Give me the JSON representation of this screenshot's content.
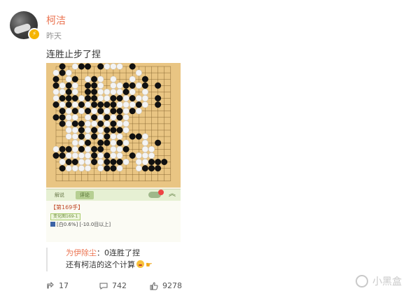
{
  "post": {
    "author": "柯洁",
    "time": "昨天",
    "text": "连胜止步了捏",
    "verified_badge_icon": "v-badge-icon"
  },
  "screenshot": {
    "board": {
      "size": 19,
      "black": [
        [
          1,
          0
        ],
        [
          1,
          1
        ],
        [
          4,
          0
        ],
        [
          5,
          0
        ],
        [
          7,
          0
        ],
        [
          12,
          0
        ],
        [
          0,
          2
        ],
        [
          3,
          2
        ],
        [
          6,
          2
        ],
        [
          14,
          2
        ],
        [
          14,
          3
        ],
        [
          16,
          3
        ],
        [
          0,
          3
        ],
        [
          2,
          3
        ],
        [
          5,
          3
        ],
        [
          6,
          3
        ],
        [
          11,
          3
        ],
        [
          12,
          3
        ],
        [
          2,
          4
        ],
        [
          5,
          4
        ],
        [
          6,
          4
        ],
        [
          11,
          4
        ],
        [
          16,
          5
        ],
        [
          1,
          5
        ],
        [
          2,
          5
        ],
        [
          3,
          5
        ],
        [
          5,
          5
        ],
        [
          6,
          5
        ],
        [
          9,
          5
        ],
        [
          10,
          5
        ],
        [
          12,
          5
        ],
        [
          0,
          6
        ],
        [
          2,
          6
        ],
        [
          4,
          6
        ],
        [
          6,
          6
        ],
        [
          7,
          6
        ],
        [
          8,
          6
        ],
        [
          9,
          6
        ],
        [
          13,
          6
        ],
        [
          16,
          6
        ],
        [
          1,
          7
        ],
        [
          3,
          7
        ],
        [
          5,
          7
        ],
        [
          7,
          7
        ],
        [
          9,
          7
        ],
        [
          10,
          7
        ],
        [
          12,
          7
        ],
        [
          0,
          8
        ],
        [
          1,
          8
        ],
        [
          6,
          8
        ],
        [
          8,
          8
        ],
        [
          10,
          8
        ],
        [
          1,
          9
        ],
        [
          3,
          9
        ],
        [
          4,
          9
        ],
        [
          7,
          9
        ],
        [
          9,
          9
        ],
        [
          4,
          10
        ],
        [
          6,
          10
        ],
        [
          8,
          10
        ],
        [
          9,
          10
        ],
        [
          10,
          10
        ],
        [
          4,
          11
        ],
        [
          6,
          11
        ],
        [
          8,
          11
        ],
        [
          12,
          11
        ],
        [
          13,
          11
        ],
        [
          5,
          12
        ],
        [
          7,
          12
        ],
        [
          8,
          12
        ],
        [
          10,
          12
        ],
        [
          16,
          12
        ],
        [
          1,
          13
        ],
        [
          2,
          13
        ],
        [
          4,
          13
        ],
        [
          6,
          13
        ],
        [
          7,
          13
        ],
        [
          11,
          13
        ],
        [
          0,
          14
        ],
        [
          1,
          14
        ],
        [
          6,
          14
        ],
        [
          8,
          14
        ],
        [
          12,
          14
        ],
        [
          2,
          15
        ],
        [
          3,
          15
        ],
        [
          6,
          15
        ],
        [
          8,
          15
        ],
        [
          9,
          15
        ],
        [
          10,
          15
        ],
        [
          15,
          15
        ],
        [
          16,
          15
        ],
        [
          1,
          16
        ],
        [
          8,
          16
        ],
        [
          9,
          16
        ],
        [
          14,
          16
        ],
        [
          15,
          16
        ],
        [
          16,
          16
        ],
        [
          17,
          15
        ]
      ],
      "white": [
        [
          0,
          1
        ],
        [
          2,
          1
        ],
        [
          3,
          0
        ],
        [
          8,
          0
        ],
        [
          9,
          0
        ],
        [
          10,
          0
        ],
        [
          13,
          1
        ],
        [
          2,
          2
        ],
        [
          5,
          2
        ],
        [
          7,
          2
        ],
        [
          9,
          2
        ],
        [
          12,
          2
        ],
        [
          1,
          3
        ],
        [
          3,
          3
        ],
        [
          7,
          3
        ],
        [
          9,
          3
        ],
        [
          10,
          3
        ],
        [
          13,
          3
        ],
        [
          0,
          4
        ],
        [
          1,
          4
        ],
        [
          3,
          4
        ],
        [
          7,
          4
        ],
        [
          8,
          4
        ],
        [
          9,
          4
        ],
        [
          10,
          4
        ],
        [
          12,
          4
        ],
        [
          14,
          4
        ],
        [
          0,
          5
        ],
        [
          4,
          5
        ],
        [
          7,
          5
        ],
        [
          8,
          5
        ],
        [
          11,
          5
        ],
        [
          13,
          5
        ],
        [
          14,
          5
        ],
        [
          1,
          6
        ],
        [
          3,
          6
        ],
        [
          5,
          6
        ],
        [
          10,
          6
        ],
        [
          11,
          6
        ],
        [
          12,
          6
        ],
        [
          14,
          6
        ],
        [
          2,
          7
        ],
        [
          4,
          7
        ],
        [
          6,
          7
        ],
        [
          8,
          7
        ],
        [
          11,
          7
        ],
        [
          13,
          7
        ],
        [
          2,
          8
        ],
        [
          3,
          8
        ],
        [
          5,
          8
        ],
        [
          7,
          8
        ],
        [
          9,
          8
        ],
        [
          11,
          8
        ],
        [
          2,
          9
        ],
        [
          5,
          9
        ],
        [
          6,
          9
        ],
        [
          8,
          9
        ],
        [
          10,
          9
        ],
        [
          11,
          9
        ],
        [
          2,
          10
        ],
        [
          3,
          10
        ],
        [
          5,
          10
        ],
        [
          7,
          10
        ],
        [
          11,
          10
        ],
        [
          2,
          11
        ],
        [
          3,
          11
        ],
        [
          5,
          11
        ],
        [
          7,
          11
        ],
        [
          9,
          11
        ],
        [
          10,
          11
        ],
        [
          14,
          11
        ],
        [
          3,
          12
        ],
        [
          4,
          12
        ],
        [
          9,
          12
        ],
        [
          11,
          12
        ],
        [
          14,
          12
        ],
        [
          0,
          13
        ],
        [
          3,
          13
        ],
        [
          5,
          13
        ],
        [
          9,
          13
        ],
        [
          10,
          13
        ],
        [
          14,
          13
        ],
        [
          15,
          13
        ],
        [
          2,
          14
        ],
        [
          3,
          14
        ],
        [
          4,
          14
        ],
        [
          5,
          14
        ],
        [
          7,
          14
        ],
        [
          9,
          14
        ],
        [
          10,
          14
        ],
        [
          13,
          14
        ],
        [
          14,
          14
        ],
        [
          15,
          14
        ],
        [
          1,
          15
        ],
        [
          4,
          15
        ],
        [
          5,
          15
        ],
        [
          7,
          15
        ],
        [
          11,
          15
        ],
        [
          13,
          15
        ],
        [
          14,
          15
        ],
        [
          2,
          16
        ],
        [
          3,
          16
        ],
        [
          4,
          16
        ],
        [
          5,
          16
        ],
        [
          7,
          16
        ],
        [
          10,
          16
        ],
        [
          13,
          16
        ]
      ]
    },
    "tabs": [
      "解说",
      "评论"
    ],
    "notif_count": "",
    "move_label": "【第169手】",
    "variation_tag": "变化图169-1",
    "info_line": "[白0.6%] [-10.0目以上]"
  },
  "quote": {
    "author": "为伊除尘",
    "text1": "：0连胜了捏",
    "text2": "还有柯洁的这个计算"
  },
  "actions": {
    "repost_count": "17",
    "comment_count": "742",
    "like_count": "9278"
  },
  "watermark": "小黑盒"
}
